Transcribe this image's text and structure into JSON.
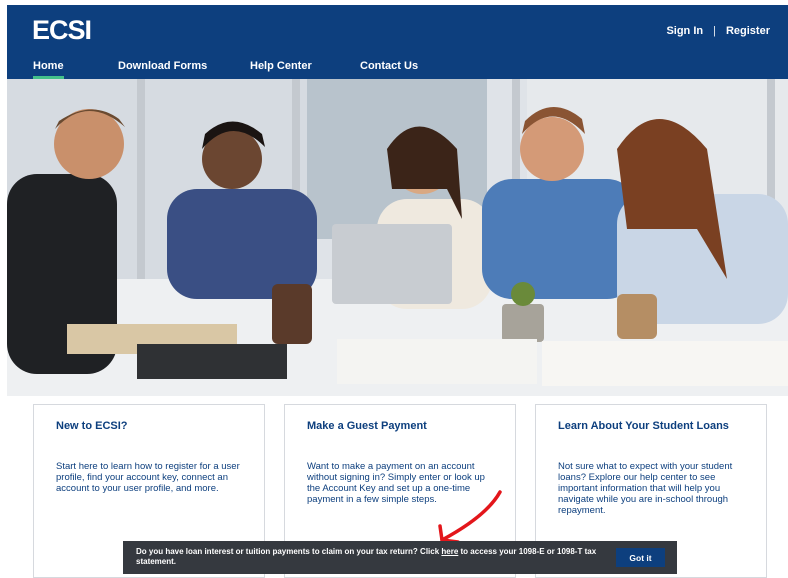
{
  "header": {
    "logo": "ECSI",
    "sign_in": "Sign In",
    "separator": "|",
    "register": "Register",
    "nav": [
      {
        "label": "Home",
        "active": true
      },
      {
        "label": "Download Forms",
        "active": false
      },
      {
        "label": "Help Center",
        "active": false
      },
      {
        "label": "Contact Us",
        "active": false
      }
    ]
  },
  "cards": [
    {
      "title": "New to ECSI?",
      "body": "Start here to learn how to register for a user profile, find your account key, connect an account to your user profile, and more."
    },
    {
      "title": "Make a Guest Payment",
      "body": "Want to make a payment on an account without signing in? Simply enter or look up the Account Key and set up a one-time payment in a few simple steps."
    },
    {
      "title": "Learn About Your Student Loans",
      "body": "Not sure what to expect with your student loans? Explore our help center to see important information that will help you navigate while you are in-school through repayment."
    }
  ],
  "cookie_banner": {
    "text_before": "Do you have loan interest or tuition payments to claim on your tax return? Click ",
    "link": "here",
    "text_after": " to access your 1098-E or 1098-T tax statement.",
    "button": "Got it"
  },
  "colors": {
    "brand_navy": "#0d3f7e",
    "nav_active_underline": "#43c08a",
    "banner_bg": "#35393f",
    "annotation_red": "#e3161b"
  }
}
